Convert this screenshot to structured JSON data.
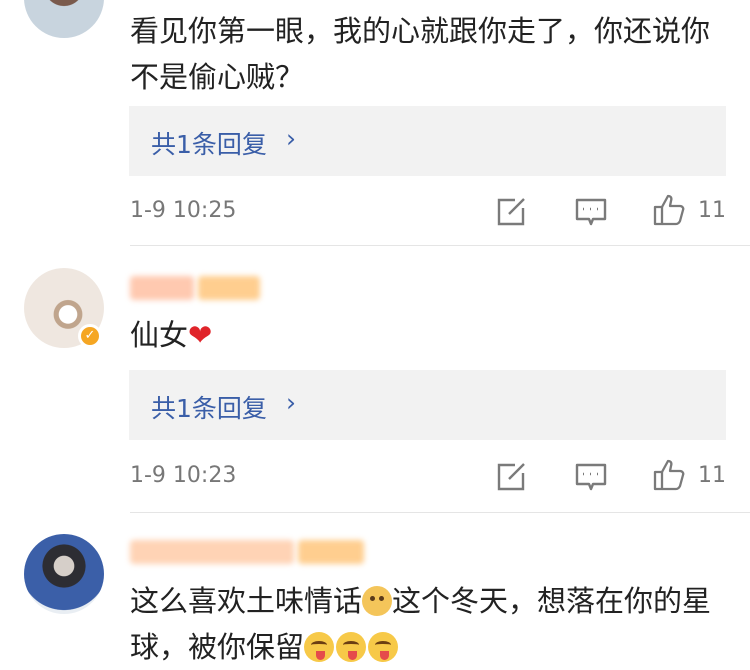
{
  "comments": [
    {
      "text": "看见你第一眼，我的心就跟你走了，你还说你不是偷心贼？",
      "reply_label": "共1条回复",
      "reply_chevron": "›",
      "timestamp": "1-9 10:25",
      "likes": "11"
    },
    {
      "text_main": "仙女",
      "text_emoji": "❤",
      "reply_label": "共1条回复",
      "reply_chevron": "›",
      "timestamp": "1-9 10:23",
      "likes": "11",
      "verified_badge": "✓"
    },
    {
      "text_part1": "这么喜欢土味情话",
      "text_part2": "这个冬天，想落在你的星球，被你保留"
    }
  ],
  "icons": [
    "avatar",
    "edit-share-icon",
    "comment-icon",
    "thumbs-up-icon",
    "verified-badge",
    "dog-emoji",
    "tongue-emoji",
    "heart-emoji"
  ],
  "colors": {
    "reply_link": "#3a5ea8",
    "meta_gray": "#777777",
    "reply_bg": "#f2f2f2",
    "badge": "#f5a623"
  }
}
